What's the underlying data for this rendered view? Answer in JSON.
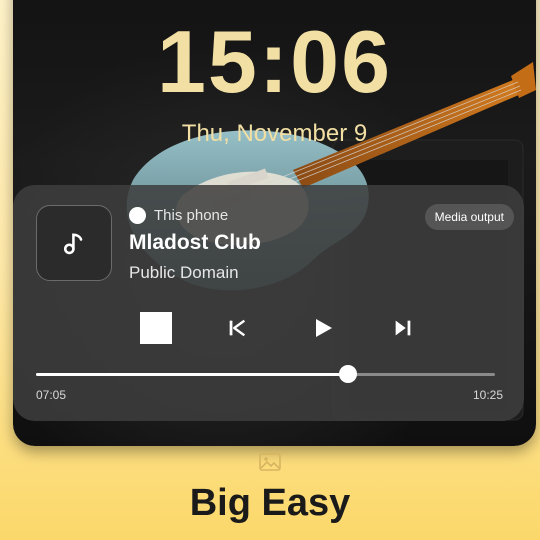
{
  "lockscreen": {
    "time": "15:06",
    "date": "Thu, November 9"
  },
  "media": {
    "source": "This phone",
    "output_label": "Media output",
    "track_title": "Mladost Club",
    "artist": "Public Domain",
    "elapsed": "07:05",
    "duration": "10:25",
    "progress_fraction": 0.68
  },
  "theme": {
    "name": "Big Easy"
  },
  "icons": [
    "music-note-icon",
    "stop-icon",
    "skip-previous-icon",
    "play-icon",
    "skip-next-icon",
    "image-icon"
  ],
  "colors": {
    "clock": "#f1dfa4",
    "card": "#3e3e3e",
    "accent_bg": "#fbd86a"
  }
}
